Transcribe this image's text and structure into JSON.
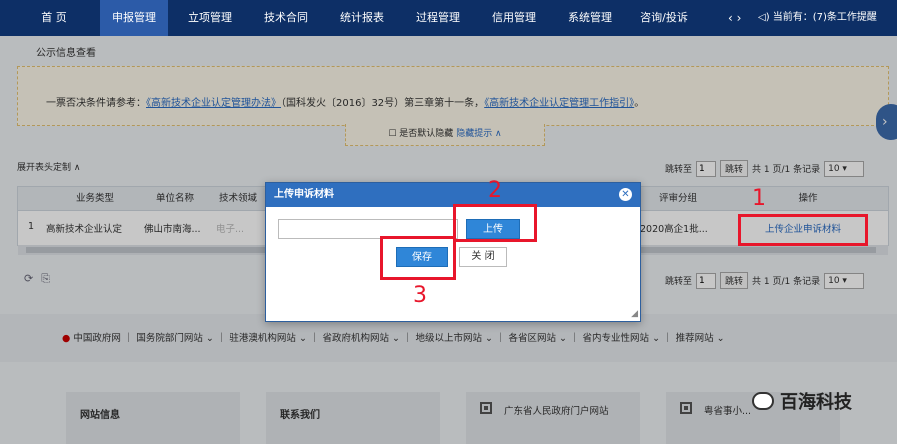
{
  "nav": {
    "items": [
      "首 页",
      "申报管理",
      "立项管理",
      "技术合同",
      "统计报表",
      "过程管理",
      "信用管理",
      "系统管理",
      "咨询/投诉"
    ],
    "arrows": "‹  ›",
    "message": "◁) 当前有：(7)条工作提醒"
  },
  "breadcrumb": "公示信息查看",
  "notice": {
    "prefix": "一票否决条件请参考：",
    "link1": "《高新技术企业认定管理办法》",
    "middle": "（国科发火〔2016〕32号）第三章第十一条，",
    "link2": "《高新技术企业认定管理工作指引》",
    "suffix": "。"
  },
  "hide_tab": {
    "checkbox_label": "是否默认隐藏",
    "link": "隐藏提示 ∧"
  },
  "custom_head": "展开表头定制 ∧",
  "pager": {
    "goto": "跳转至",
    "page": "1",
    "go": "跳转",
    "total": "共 1 页/1 条记录",
    "size": "10 ▾"
  },
  "table": {
    "headers": [
      "业务类型",
      "单位名称",
      "技术领域",
      "评审分组",
      "操作"
    ],
    "row": {
      "index": "1",
      "type": "高新技术企业认定",
      "unit": "佛山市南海...",
      "field": "电子...",
      "group": "2020高企1批...",
      "action": "上传企业申诉材料"
    }
  },
  "tools": {
    "refresh": "⟳",
    "export": "⎘"
  },
  "footer": {
    "links": [
      "中国政府网",
      "国务院部门网站 ⌄",
      "驻港澳机构网站 ⌄",
      "省政府机构网站 ⌄",
      "地级以上市网站 ⌄",
      "各省区网站 ⌄",
      "省内专业性网站 ⌄",
      "推荐网站 ⌄"
    ],
    "cards": [
      "网站信息",
      "联系我们",
      "广东省人民政府门户网站",
      "粤省事小..."
    ]
  },
  "modal": {
    "title": "上传申诉材料",
    "close_icon": "✕",
    "upload": "上传",
    "save": "保存",
    "close": "关 闭"
  },
  "annotations": [
    "1",
    "2",
    "3"
  ],
  "watermark": "百海科技"
}
